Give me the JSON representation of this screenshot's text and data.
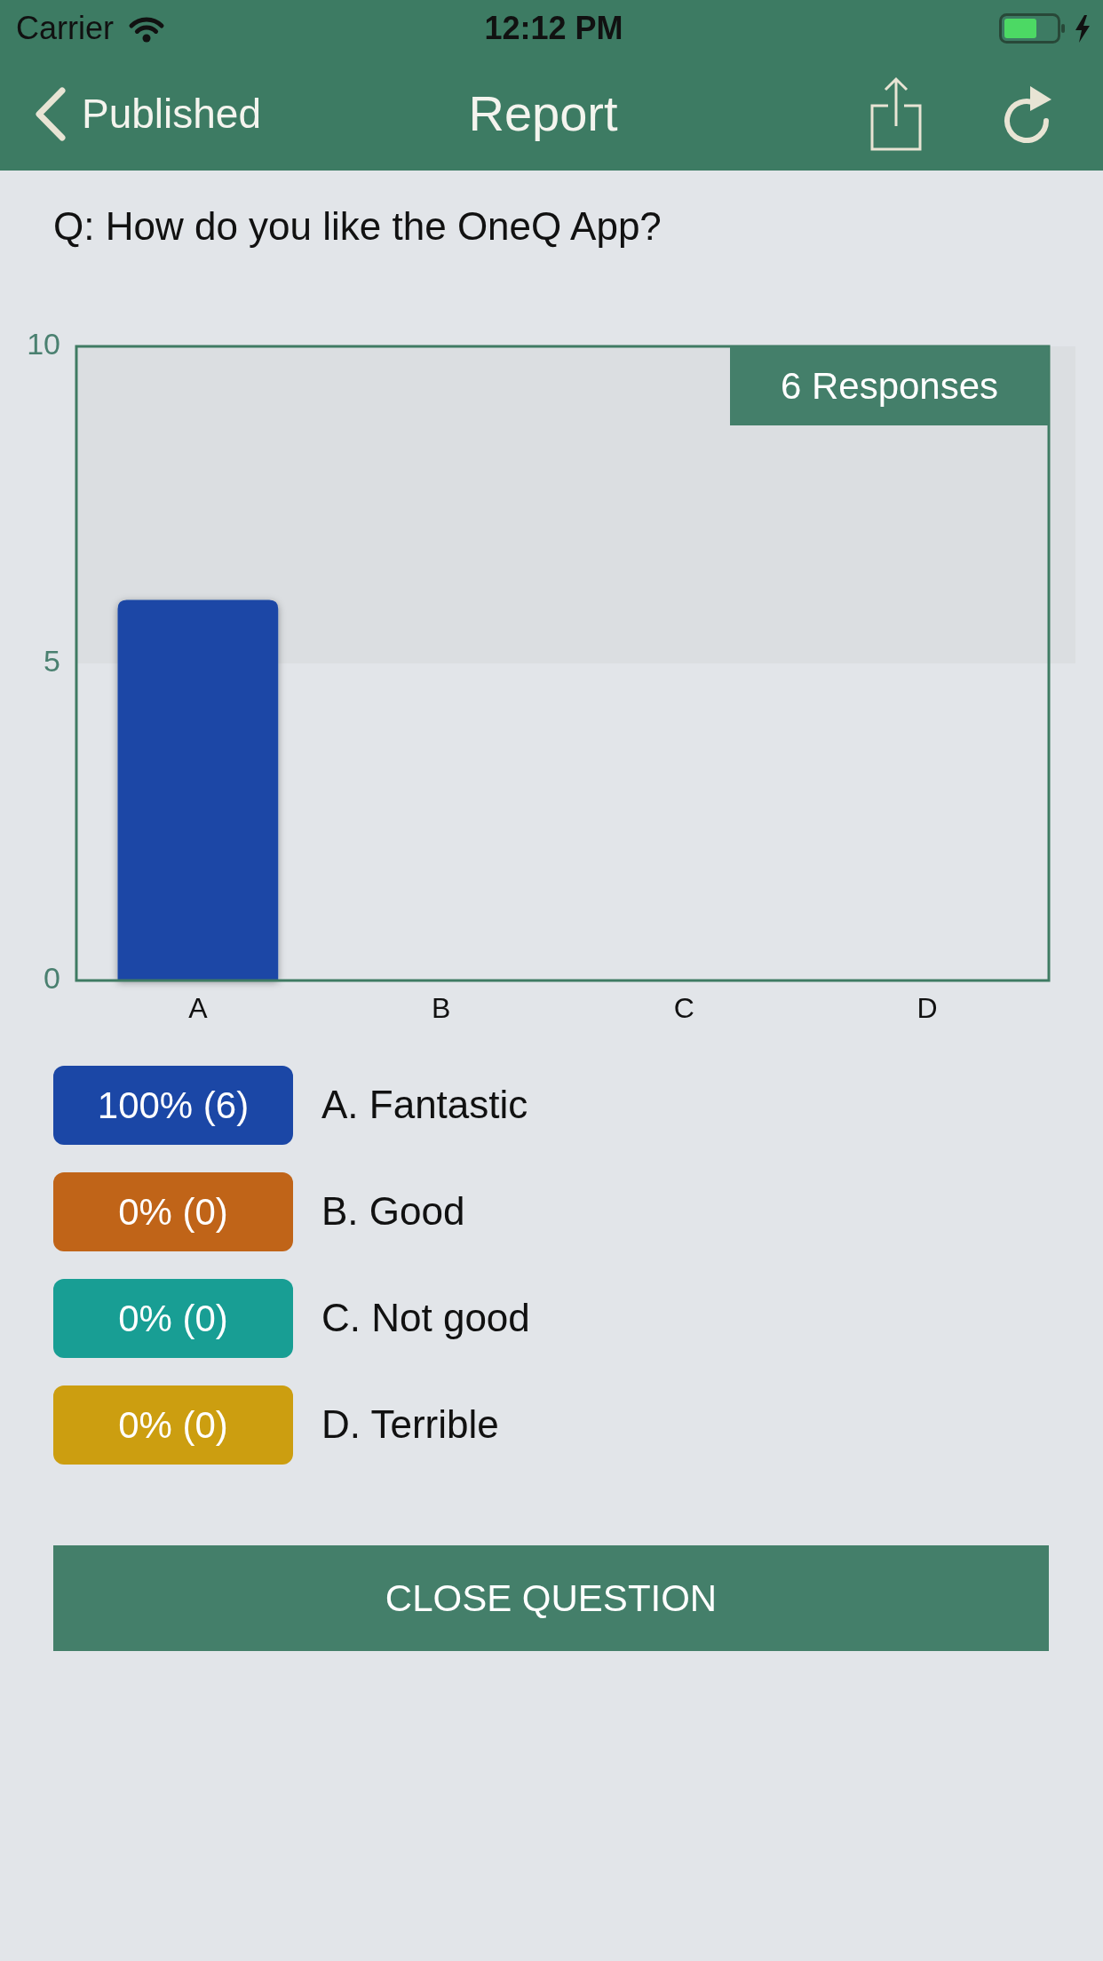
{
  "status_bar": {
    "carrier": "Carrier",
    "time": "12:12 PM"
  },
  "nav_bar": {
    "back_label": "Published",
    "title": "Report"
  },
  "question": "Q: How do you like the OneQ App?",
  "chart": {
    "responses_badge": "6 Responses",
    "chart_data": {
      "type": "bar",
      "categories": [
        "A",
        "B",
        "C",
        "D"
      ],
      "series": [
        {
          "color": "#1a47a6",
          "values": [
            6,
            0,
            0,
            0
          ]
        }
      ],
      "ylim": [
        0,
        10
      ],
      "yticks": [
        0,
        5,
        10
      ]
    }
  },
  "answers": [
    {
      "result": "100% (6)",
      "label": "A. Fantastic",
      "color": "#1b47a6"
    },
    {
      "result": "0% (0)",
      "label": "B. Good",
      "color": "#c06418"
    },
    {
      "result": "0% (0)",
      "label": "C. Not good",
      "color": "#189e94"
    },
    {
      "result": "0% (0)",
      "label": "D. Terrible",
      "color": "#cc9e10"
    }
  ],
  "close_button": "CLOSE QUESTION"
}
